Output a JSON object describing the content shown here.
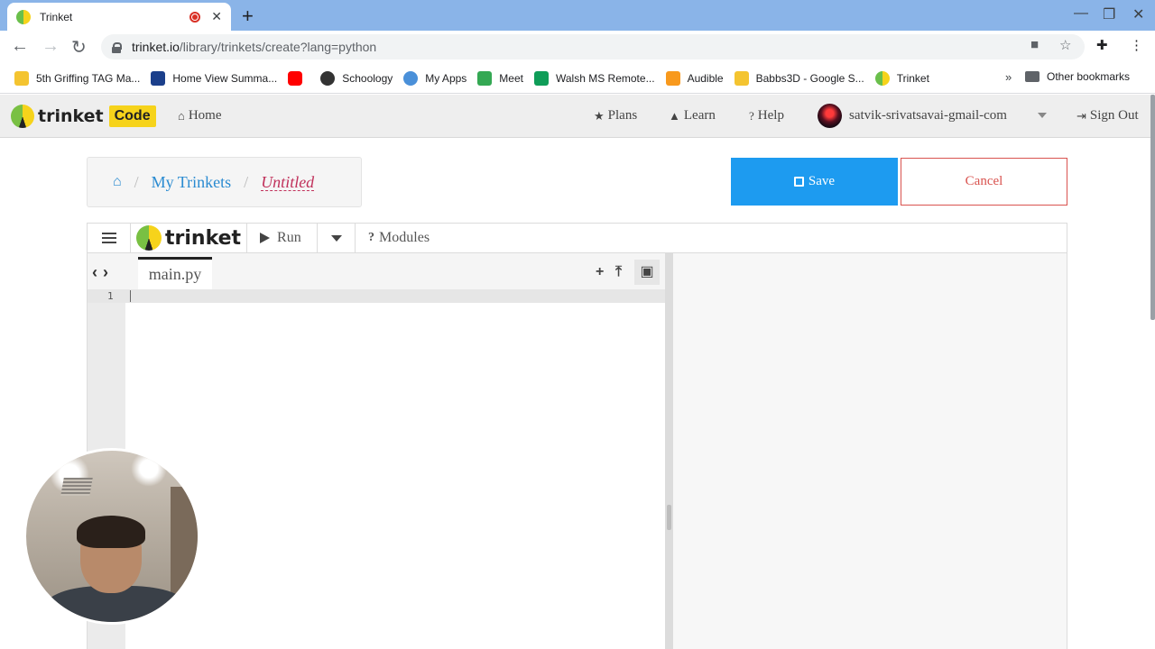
{
  "browser": {
    "tab_title": "Trinket",
    "url_host": "trinket.io",
    "url_path": "/library/trinkets/create?lang=python",
    "bookmarks": [
      {
        "label": "5th Griffing TAG Ma...",
        "color": "#f4c430"
      },
      {
        "label": "Home View Summa...",
        "color": "#1b3f8b"
      },
      {
        "label": "",
        "color": "#ff0000"
      },
      {
        "label": "Schoology",
        "color": "#333333"
      },
      {
        "label": "My Apps",
        "color": "#4a90d9"
      },
      {
        "label": "Meet",
        "color": "#34a853"
      },
      {
        "label": "Walsh MS Remote...",
        "color": "#0f9d58"
      },
      {
        "label": "Audible",
        "color": "#f8991d"
      },
      {
        "label": "Babbs3D - Google S...",
        "color": "#f4c430"
      },
      {
        "label": "Trinket",
        "color": "#f6d31b"
      }
    ],
    "other_bookmarks": "Other bookmarks"
  },
  "header": {
    "logo_word": "trinket",
    "logo_badge": "Code",
    "home": "Home",
    "plans": "Plans",
    "learn": "Learn",
    "help": "Help",
    "user": "satvik-srivatsavai-gmail-com",
    "sign_out": "Sign Out"
  },
  "breadcrumb": {
    "my_trinkets": "My Trinkets",
    "current": "Untitled"
  },
  "actions": {
    "save": "Save",
    "cancel": "Cancel"
  },
  "editor": {
    "brand": "trinket",
    "run": "Run",
    "modules": "Modules",
    "file_name": "main.py",
    "line_numbers": [
      "1"
    ]
  },
  "colors": {
    "accent": "#1d9bf0",
    "cancel": "#d9534f",
    "brand_yellow": "#f6d31b"
  }
}
